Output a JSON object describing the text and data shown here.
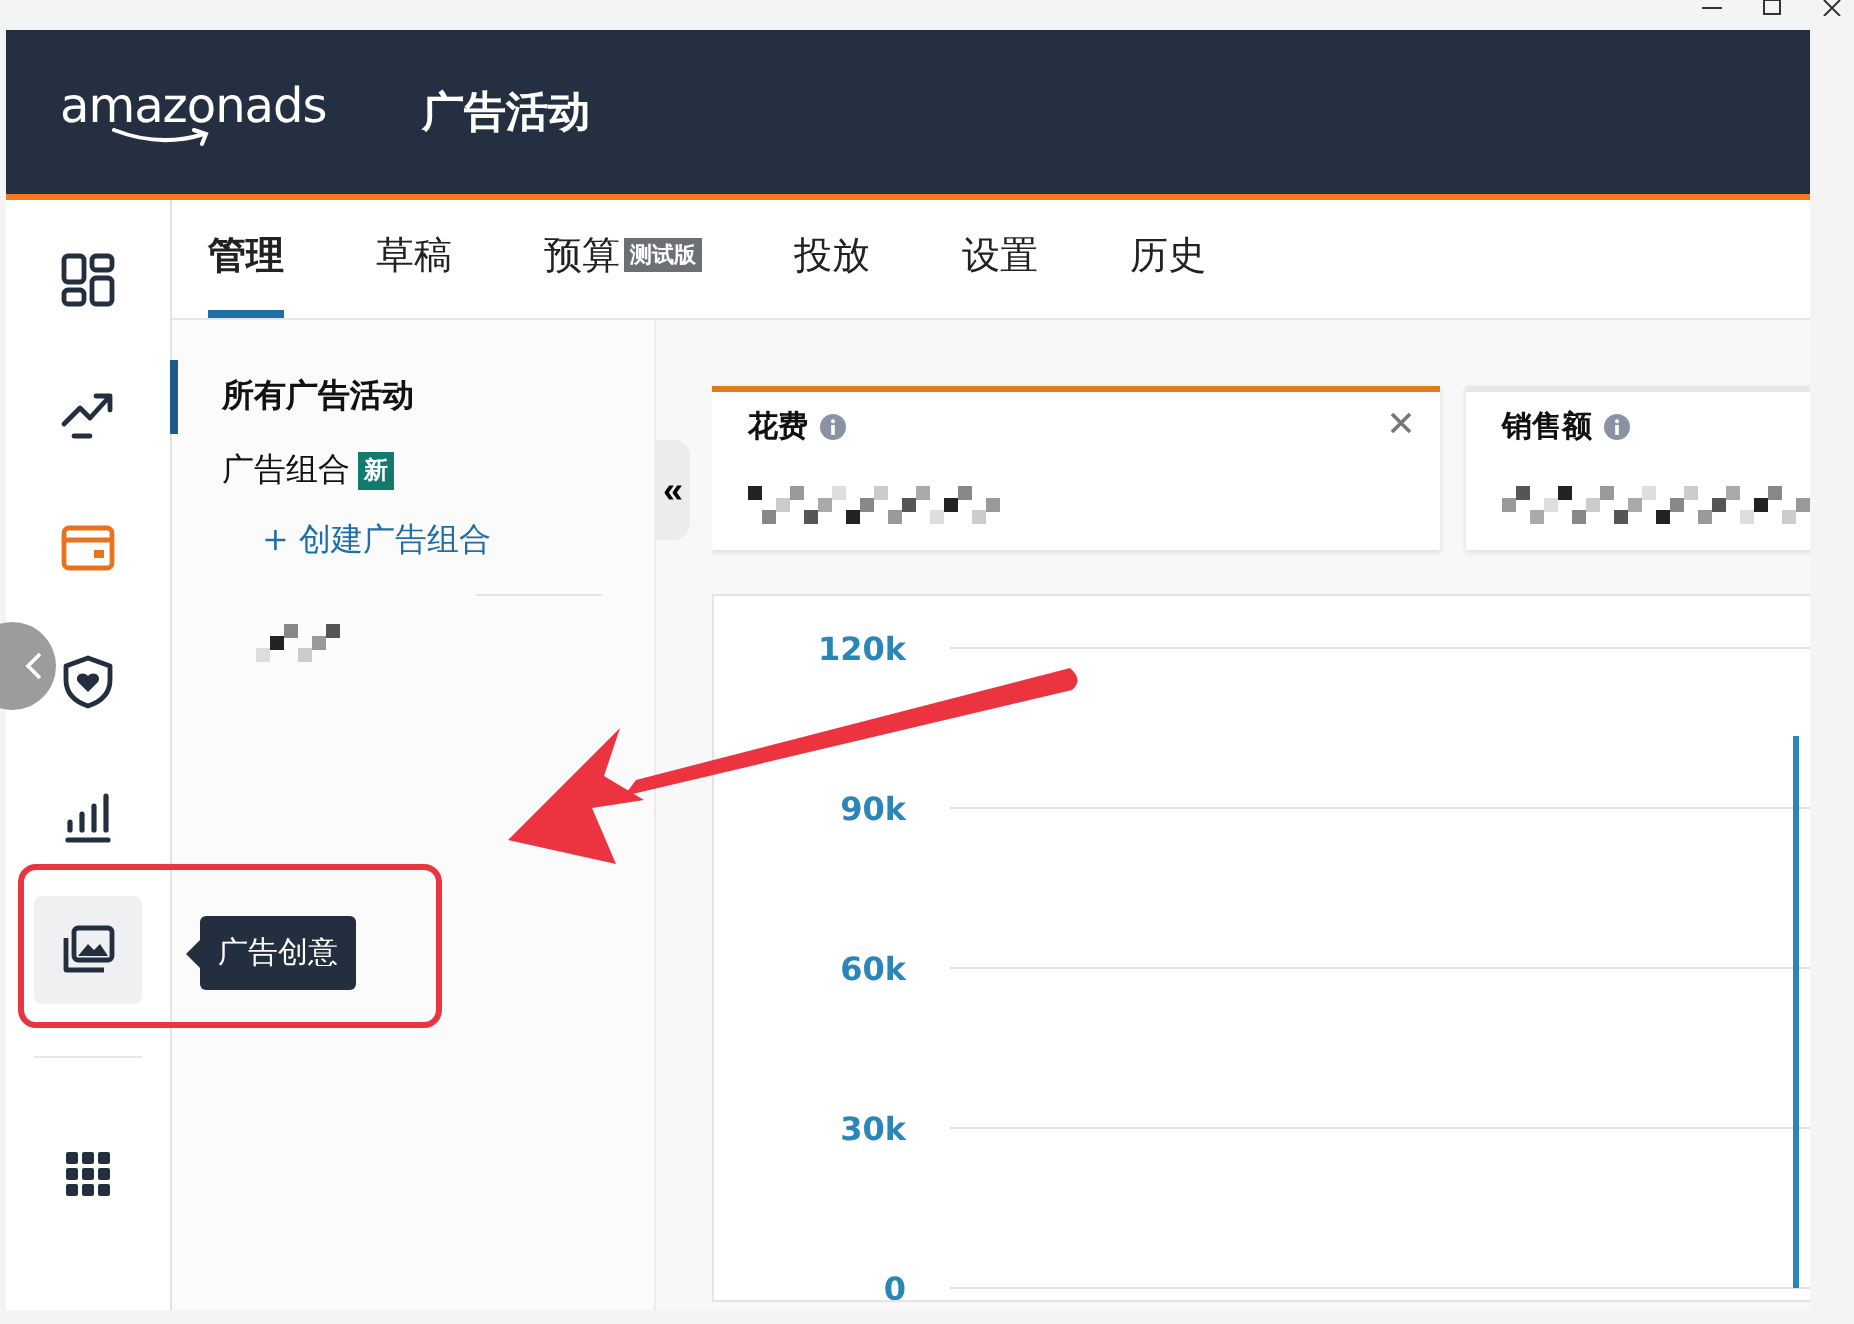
{
  "header": {
    "logo": "amazonads",
    "title": "广告活动"
  },
  "rail": {
    "items": [
      {
        "kind": "dashboard",
        "selected": false,
        "hovered": false
      },
      {
        "kind": "trend",
        "selected": false,
        "hovered": false
      },
      {
        "kind": "card",
        "selected": true,
        "hovered": false
      },
      {
        "kind": "shield",
        "selected": false,
        "hovered": false
      },
      {
        "kind": "bars",
        "selected": false,
        "hovered": false
      },
      {
        "kind": "images",
        "selected": false,
        "hovered": true
      }
    ]
  },
  "tooltip": "广告创意",
  "tabs": [
    {
      "label": "管理",
      "selected": true
    },
    {
      "label": "草稿",
      "selected": false
    },
    {
      "label": "预算",
      "badge": "测试版",
      "selected": false
    },
    {
      "label": "投放",
      "selected": false
    },
    {
      "label": "设置",
      "selected": false
    },
    {
      "label": "历史",
      "selected": false
    }
  ],
  "subnav": {
    "items": [
      {
        "label": "所有广告活动",
        "selected": true
      },
      {
        "label": "广告组合",
        "badge": "新",
        "selected": false
      }
    ],
    "create_link": "+ 创建广告组合"
  },
  "collapse_button": "«",
  "metrics": [
    {
      "label": "花费",
      "selected": true,
      "closable": true
    },
    {
      "label": "销售额",
      "selected": false
    }
  ],
  "chart": {
    "y_labels": [
      "120k",
      "90k",
      "60k",
      "30k",
      "0"
    ]
  }
}
